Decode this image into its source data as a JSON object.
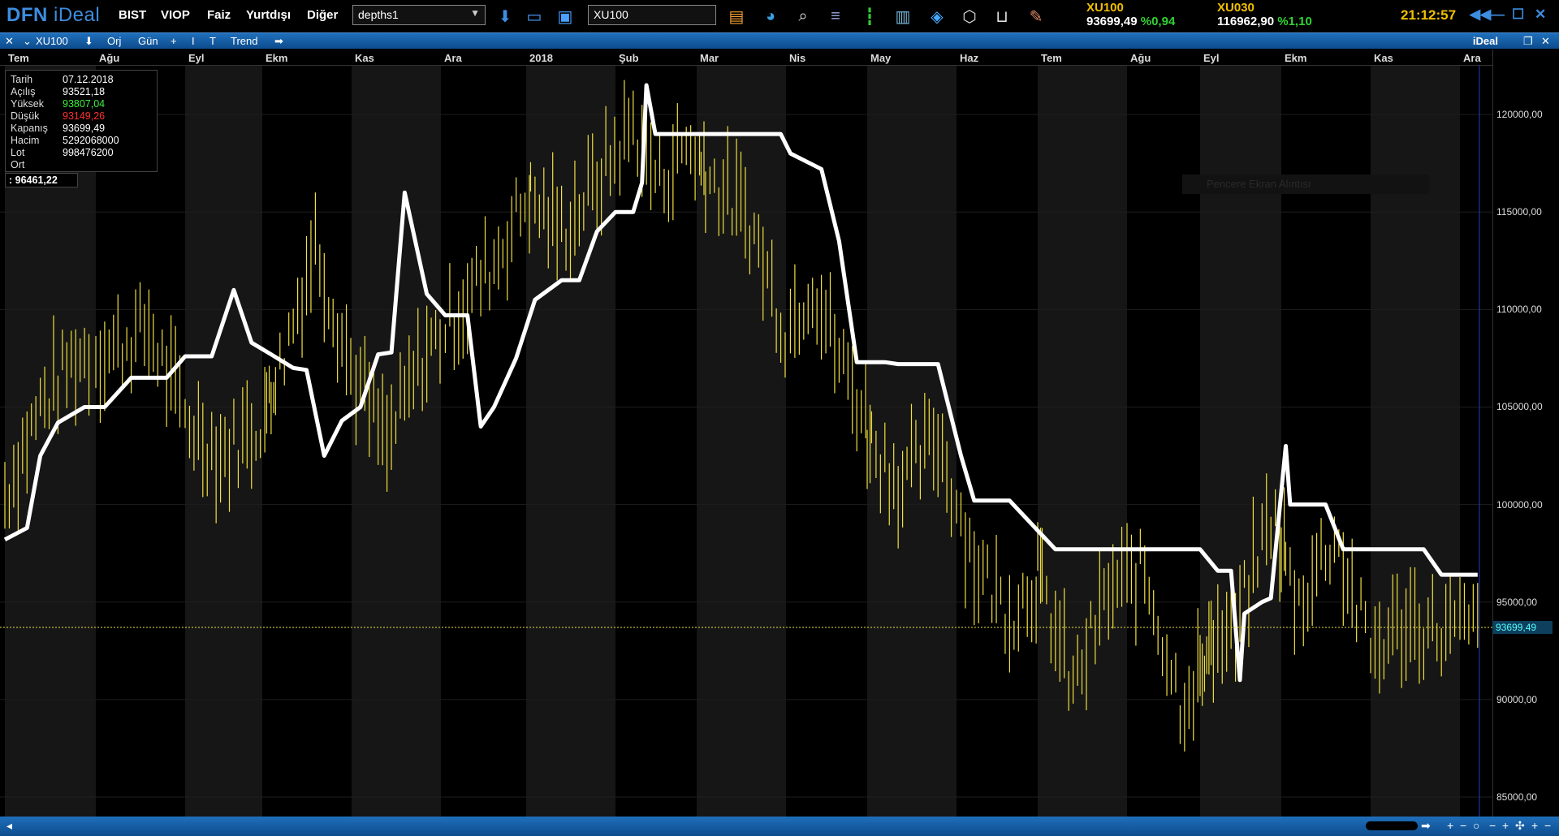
{
  "app": {
    "logo_main": "DFN",
    "logo_sub": "iDeal",
    "menu": [
      "BIST",
      "VIOP",
      "Faiz",
      "Yurtdışı",
      "Diğer"
    ],
    "layout_select": "depths1",
    "symbol_input": "XU100",
    "quotes": [
      {
        "name": "XU100",
        "value": "93699,49",
        "change": "%0,94"
      },
      {
        "name": "XU030",
        "value": "116962,90",
        "change": "%1,10"
      }
    ],
    "clock": "21:12:57",
    "window_buttons": [
      "◀◀",
      "—",
      "☐",
      "✕"
    ]
  },
  "chart_toolbar": {
    "symbol": "XU100",
    "orj": "Orj",
    "period": "Gün",
    "trend": "Trend",
    "brand": "iDeal"
  },
  "info": {
    "rows": [
      {
        "k": "Tarih",
        "v": "07.12.2018",
        "cls": ""
      },
      {
        "k": "Açılış",
        "v": "93521,18",
        "cls": ""
      },
      {
        "k": "Yüksek",
        "v": "93807,04",
        "cls": "up"
      },
      {
        "k": "Düşük",
        "v": "93149,26",
        "cls": "dn"
      },
      {
        "k": "Kapanış",
        "v": "93699,49",
        "cls": ""
      },
      {
        "k": "Hacim",
        "v": "5292068000",
        "cls": ""
      },
      {
        "k": "Lot",
        "v": "998476200",
        "cls": ""
      },
      {
        "k": "Ort",
        "v": "",
        "cls": ""
      }
    ],
    "ort_value": ": 96461,22"
  },
  "watermark": "Pencere Ekran Alıntısı",
  "colors": {
    "price_bars": "#f0e040",
    "trend_line": "#ffffff",
    "last_price_line": "#f0e040",
    "band_alt": "#161616"
  },
  "chart_data": {
    "type": "line",
    "symbol": "XU100",
    "x_months": [
      "Tem",
      "Ağu",
      "Eyl",
      "Ekm",
      "Kas",
      "Ara",
      "2018",
      "Şub",
      "Mar",
      "Nis",
      "May",
      "Haz",
      "Tem",
      "Ağu",
      "Eyl",
      "Ekm",
      "Kas",
      "Ara"
    ],
    "price_axis_labels": [
      "120000,00",
      "115000,00",
      "110000,00",
      "105000,00",
      "100000,00",
      "95000,00",
      "90000,00",
      "85000,00"
    ],
    "price_axis_values": [
      120000,
      115000,
      110000,
      105000,
      100000,
      95000,
      90000,
      85000
    ],
    "ylim": [
      84000,
      122500
    ],
    "last_price": 93699.49,
    "last_price_label": "93699,49",
    "price_path_months": [
      0,
      0.4,
      0.8,
      1.2,
      1.6,
      2.0,
      2.4,
      2.8,
      3.2,
      3.6,
      4.0,
      4.4,
      4.8,
      5.2,
      5.6,
      6.0,
      6.4,
      6.8,
      7.2,
      7.5,
      7.8,
      8.2,
      8.6,
      9.0,
      9.3,
      9.6,
      10.0,
      10.4,
      10.8,
      11.2,
      11.6,
      12.0,
      12.4,
      12.8,
      13.2,
      13.6,
      14.0,
      14.4,
      14.8,
      15.2,
      15.6,
      16.0,
      16.4,
      16.8,
      17.2
    ],
    "price_path_values": [
      100500,
      105000,
      107500,
      108000,
      109000,
      104500,
      102500,
      104000,
      107000,
      113500,
      107000,
      103000,
      107500,
      110000,
      112500,
      116000,
      114000,
      116500,
      119500,
      116500,
      118500,
      116500,
      114500,
      109000,
      111500,
      107500,
      103500,
      101000,
      103500,
      97000,
      94500,
      96500,
      90500,
      95500,
      96500,
      90000,
      92500,
      93500,
      99500,
      95000,
      98500,
      92500,
      94000,
      93500,
      93700
    ],
    "trend_months": [
      0,
      0.25,
      0.4,
      0.6,
      0.9,
      1.1,
      1.4,
      1.8,
      2.0,
      2.3,
      2.55,
      2.75,
      3.1,
      3.35,
      3.5,
      3.7,
      3.9,
      4.1,
      4.3,
      4.45,
      4.6,
      4.85,
      5.05,
      5.3,
      5.45,
      5.6,
      5.85,
      6.1,
      6.4,
      6.6,
      6.8,
      7.0,
      7.2,
      7.3,
      7.35,
      7.45,
      7.7,
      8.0,
      8.5,
      8.95,
      9.05,
      9.4,
      9.6,
      9.8,
      10.0,
      10.2,
      10.35,
      10.8,
      11.05,
      11.2,
      11.4,
      11.6,
      12.2,
      12.4,
      12.6,
      13.0,
      13.5,
      14.0,
      14.2,
      14.35,
      14.45,
      14.5,
      14.7,
      14.8,
      15.05,
      15.1,
      15.15,
      15.2,
      15.5,
      15.7,
      16.0,
      16.6,
      16.8,
      17.2
    ],
    "trend_values": [
      98200,
      98800,
      102500,
      104200,
      105000,
      105000,
      106500,
      106500,
      107600,
      107600,
      111000,
      108300,
      107700,
      107000,
      106900,
      102500,
      104300,
      105000,
      107700,
      107800,
      116000,
      110800,
      109700,
      109700,
      104000,
      105000,
      107500,
      110500,
      111500,
      111500,
      114000,
      115000,
      115000,
      116500,
      121500,
      119000,
      119000,
      119000,
      119000,
      119000,
      118000,
      117200,
      113500,
      107300,
      107300,
      107300,
      107200,
      107200,
      102500,
      100200,
      100200,
      100200,
      97700,
      97700,
      97700,
      97700,
      97700,
      97700,
      96600,
      96600,
      91000,
      94400,
      95000,
      95200,
      103000,
      100000,
      100000,
      100000,
      100000,
      97700,
      97700,
      97700,
      96400,
      96400
    ]
  }
}
